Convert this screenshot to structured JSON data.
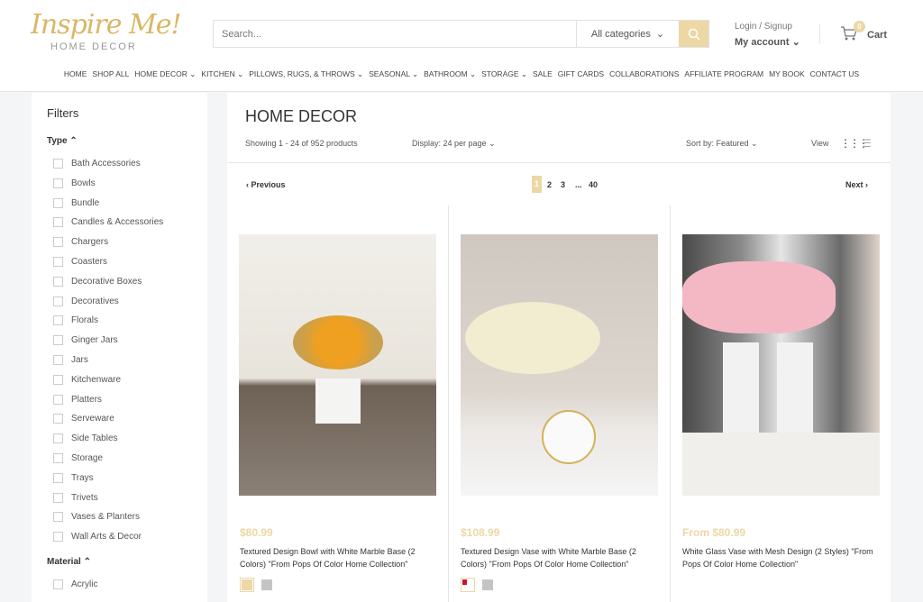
{
  "header": {
    "logo_text": "Inspire Me!",
    "logo_sub": "HOME DECOR",
    "search_placeholder": "Search...",
    "category": "All categories",
    "login": "Login / Signup",
    "account": "My account",
    "cart_count": "0",
    "cart": "Cart"
  },
  "nav": [
    "HOME",
    "SHOP ALL",
    "HOME DECOR ⌄",
    "KITCHEN ⌄",
    "PILLOWS, RUGS, & THROWS ⌄",
    "SEASONAL ⌄",
    "BATHROOM ⌄",
    "STORAGE ⌄",
    "SALE",
    "GIFT CARDS",
    "COLLABORATIONS",
    "AFFILIATE PROGRAM",
    "MY BOOK",
    "CONTACT US"
  ],
  "filters": {
    "title": "Filters",
    "type_label": "Type",
    "types": [
      "Bath Accessories",
      "Bowls",
      "Bundle",
      "Candles & Accessories",
      "Chargers",
      "Coasters",
      "Decorative Boxes",
      "Decoratives",
      "Florals",
      "Ginger Jars",
      "Jars",
      "Kitchenware",
      "Platters",
      "Serveware",
      "Side Tables",
      "Storage",
      "Trays",
      "Trivets",
      "Vases & Planters",
      "Wall Arts & Decor"
    ],
    "material_label": "Material",
    "materials": [
      "Acrylic"
    ]
  },
  "main": {
    "title": "HOME DECOR",
    "showing": "Showing 1 - 24 of 952 products",
    "display": "Display: 24 per page",
    "sort": "Sort by: Featured",
    "view": "View",
    "prev": "‹ Previous",
    "next": "Next ›",
    "pages": [
      "1",
      "2",
      "3",
      "...",
      "40"
    ]
  },
  "products": [
    {
      "price": "$80.99",
      "name": "Textured Design Bowl with White Marble Base (2 Colors) \"From Pops Of Color Home Collection\"",
      "swatches": [
        "#ecd7a5",
        "#c4c4c4"
      ]
    },
    {
      "price": "$108.99",
      "name": "Textured Design Vase with White Marble Base (2 Colors) \"From Pops Of Color Home Collection\"",
      "swatches": [
        "#cc1133",
        "#c4c4c4"
      ]
    },
    {
      "price": "From $80.99",
      "name": "White Glass Vase with Mesh Design (2 Styles) \"From Pops Of Color Home Collection\"",
      "swatches": []
    }
  ],
  "colors": {
    "accent": "#ecd7a5"
  }
}
